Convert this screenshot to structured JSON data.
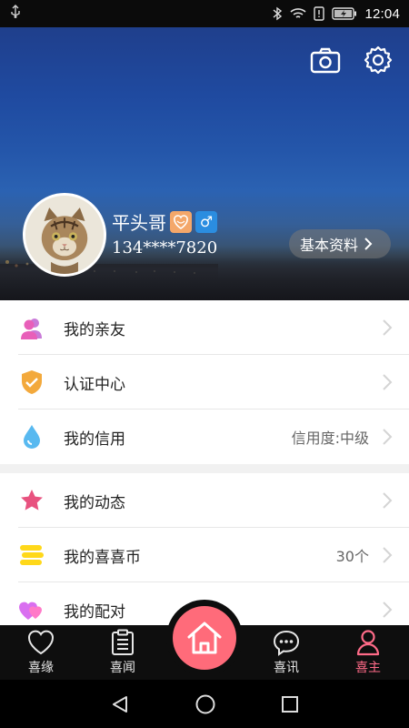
{
  "status_bar": {
    "time": "12:04",
    "usb_icon": "usb-icon",
    "bluetooth_icon": "bluetooth-icon",
    "wifi_icon": "wifi-icon",
    "alert_icon": "sim-alert-icon",
    "battery_icon": "battery-charging-icon"
  },
  "header": {
    "camera_icon": "camera-icon",
    "settings_icon": "settings-gear-icon",
    "user": {
      "name": "平头哥",
      "phone": "134****7820",
      "badge_icon": "heart-badge-icon",
      "gender_symbol": "♂"
    },
    "profile_button": {
      "label": "基本资料"
    }
  },
  "menu": {
    "group1": [
      {
        "label": "我的亲友",
        "icon": "friends-icon"
      },
      {
        "label": "认证中心",
        "icon": "shield-check-icon"
      },
      {
        "label": "我的信用",
        "icon": "drop-icon",
        "value": "信用度:中级"
      }
    ],
    "group2": [
      {
        "label": "我的动态",
        "icon": "star-icon"
      },
      {
        "label": "我的喜喜币",
        "icon": "coins-icon",
        "value": "30个"
      },
      {
        "label": "我的配对",
        "icon": "hearts-icon"
      }
    ]
  },
  "tabbar": {
    "tabs": [
      {
        "label": "喜缘",
        "icon": "heart-outline-icon"
      },
      {
        "label": "喜闻",
        "icon": "clipboard-icon"
      },
      {
        "label": "",
        "icon": "home-icon"
      },
      {
        "label": "喜讯",
        "icon": "chat-bubble-icon"
      },
      {
        "label": "喜主",
        "icon": "user-icon"
      }
    ],
    "active_color": "#ff6b88"
  },
  "navbar": {
    "back_icon": "back-triangle-icon",
    "home_icon": "home-circle-icon",
    "recents_icon": "recents-square-icon"
  },
  "colors": {
    "accent": "#ff6b7a",
    "gender_badge": "#2b8de0",
    "heart_badge": "#f4a76a"
  }
}
